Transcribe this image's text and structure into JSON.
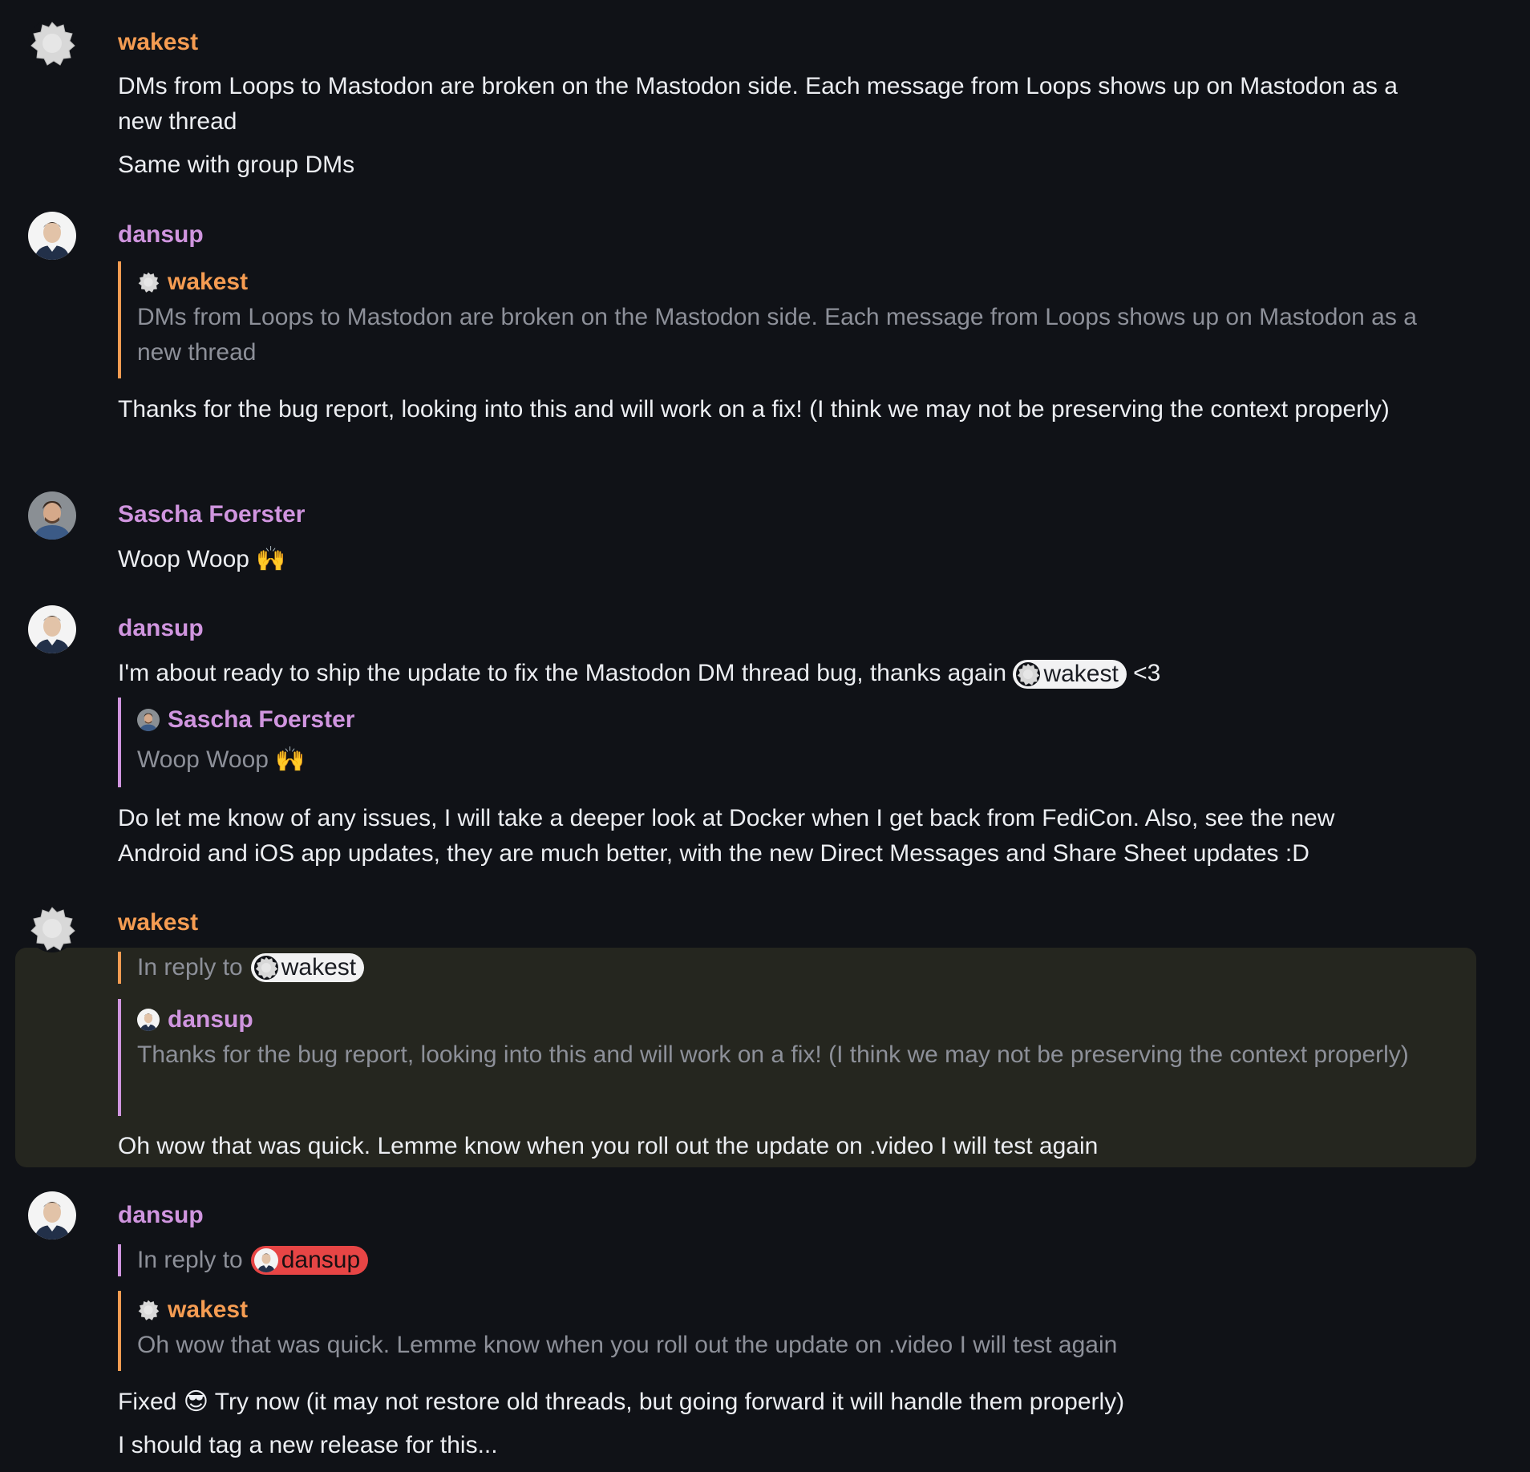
{
  "messages": [
    {
      "author": "wakest",
      "lines": [
        "DMs from Loops to Mastodon are broken on the Mastodon side. Each message from Loops shows up on Mastodon as a new thread",
        "Same with group DMs"
      ]
    },
    {
      "author": "dansup",
      "quote": {
        "author": "wakest",
        "text": "DMs from Loops to Mastodon are broken on the Mastodon side. Each message from Loops shows up on Mastodon as a new thread"
      },
      "text": "Thanks for the bug report, looking into this and will work on a fix! (I think we may not be preserving the context properly)"
    },
    {
      "author": "Sascha Foerster",
      "text": "Woop Woop",
      "emoji": "🙌"
    },
    {
      "author": "dansup",
      "text_before": "I'm about ready to ship the update to fix the Mastodon DM thread bug, thanks again",
      "mention": "wakest",
      "text_after": "<3",
      "quote": {
        "author": "Sascha Foerster",
        "text": "Woop Woop",
        "emoji": "🙌"
      },
      "text": "Do let me know of any issues, I will take a deeper look at Docker when I get back from FediCon. Also, see the new Android and iOS app updates, they are much better, with the new Direct Messages and Share Sheet updates :D"
    },
    {
      "author": "wakest",
      "reply_label": "In reply to",
      "reply_to": "wakest",
      "quote": {
        "author": "dansup",
        "text": "Thanks for the bug report, looking into this and will work on a fix! (I think we may not be preserving the context properly)"
      },
      "text": "Oh wow that was quick. Lemme know when you roll out the update on .video I will test again"
    },
    {
      "author": "dansup",
      "reply_label": "In reply to",
      "reply_to": "dansup",
      "quote": {
        "author": "wakest",
        "text": "Oh wow that was quick. Lemme know when you roll out the update on .video I will test again"
      },
      "text_before": "Fixed",
      "emoji": "😎",
      "text_after": "Try now (it may not restore old threads, but going forward it will handle them properly)",
      "text2": "I should tag a new release for this..."
    }
  ],
  "colors": {
    "background": "#101217",
    "wakest_name": "#f59c52",
    "dansup_name": "#d095df",
    "highlight_bg": "#25261f",
    "mention_red": "#e74545"
  }
}
